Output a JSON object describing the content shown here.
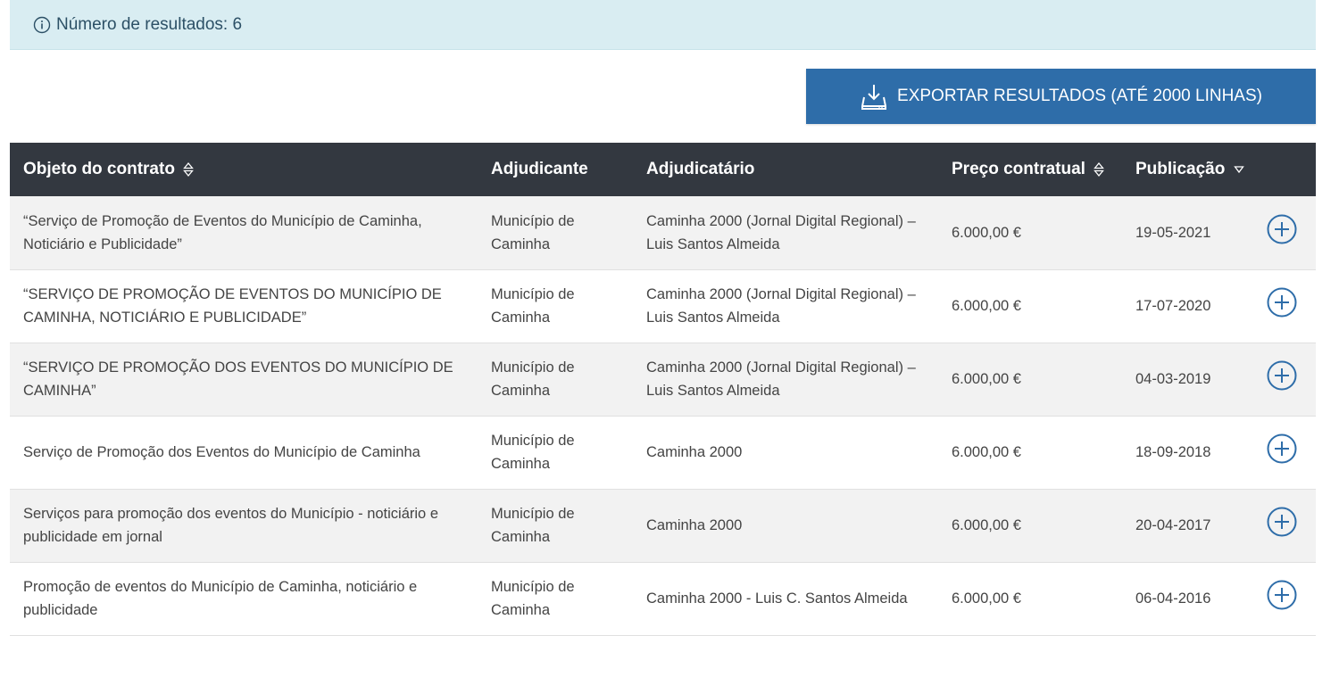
{
  "info": {
    "results_text": "Número de resultados: 6",
    "icon": "info-circle-icon"
  },
  "export": {
    "label": "EXPORTAR RESULTADOS (ATÉ 2000 LINHAS)",
    "icon": "download-tray-icon"
  },
  "table": {
    "headers": {
      "objeto": "Objeto do contrato",
      "adjudicante": "Adjudicante",
      "adjudicatario": "Adjudicatário",
      "preco": "Preço contratual",
      "publicacao": "Publicação"
    },
    "rows": [
      {
        "objeto": "“Serviço de Promoção de Eventos do Município de Caminha, Noticiário e Publicidade”",
        "adjudicante": "Município de Caminha",
        "adjudicatario": "Caminha 2000 (Jornal Digital Regional) – Luis Santos Almeida",
        "preco": "6.000,00 €",
        "publicacao": "19-05-2021"
      },
      {
        "objeto": "“SERVIÇO DE PROMOÇÃO DE EVENTOS DO MUNICÍPIO DE CAMINHA, NOTICIÁRIO E PUBLICIDADE”",
        "adjudicante": "Município de Caminha",
        "adjudicatario": "Caminha 2000 (Jornal Digital Regional) – Luis Santos Almeida",
        "preco": "6.000,00 €",
        "publicacao": "17-07-2020"
      },
      {
        "objeto": "“SERVIÇO DE PROMOÇÃO DOS EVENTOS DO MUNICÍPIO DE CAMINHA”",
        "adjudicante": "Município de Caminha",
        "adjudicatario": "Caminha 2000 (Jornal Digital Regional) – Luis Santos Almeida",
        "preco": "6.000,00 €",
        "publicacao": "04-03-2019"
      },
      {
        "objeto": "Serviço de Promoção dos Eventos do Município de Caminha",
        "adjudicante": "Município de Caminha",
        "adjudicatario": "Caminha 2000",
        "preco": "6.000,00 €",
        "publicacao": "18-09-2018"
      },
      {
        "objeto": "Serviços para promoção dos eventos do Município - noticiário e publicidade em jornal",
        "adjudicante": "Município de Caminha",
        "adjudicatario": "Caminha 2000",
        "preco": "6.000,00 €",
        "publicacao": "20-04-2017"
      },
      {
        "objeto": "Promoção de eventos do Município de Caminha, noticiário e publicidade",
        "adjudicante": "Município de Caminha",
        "adjudicatario": "Caminha 2000 - Luis C. Santos Almeida",
        "preco": "6.000,00 €",
        "publicacao": "06-04-2016"
      }
    ]
  },
  "colors": {
    "info_bg": "#d9edf2",
    "accent": "#2e6da9",
    "header_bg": "#333840",
    "plus_icon": "#2e6da9"
  }
}
